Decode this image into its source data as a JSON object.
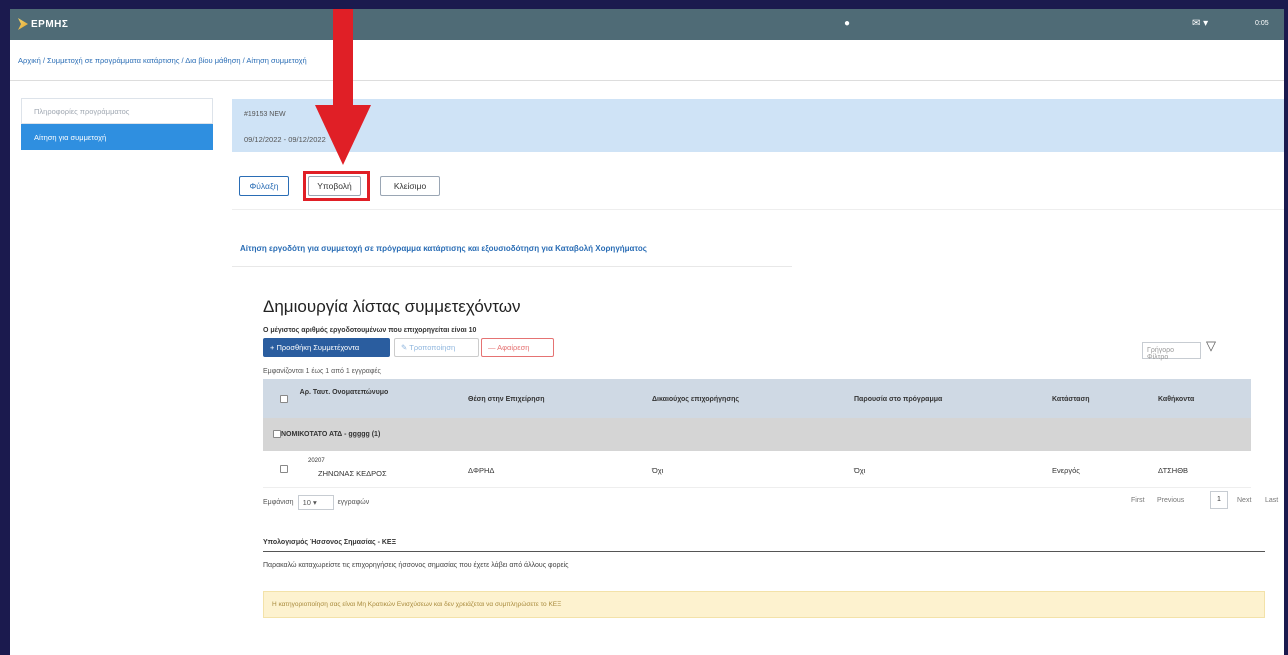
{
  "app": {
    "name": "ΕΡΜΗΣ",
    "time": "0:05"
  },
  "breadcrumb": {
    "text": "Αρχική / Συμμετοχή σε προγράμματα κατάρτισης / Δια βίου μάθηση / Αίτηση συμμετοχή"
  },
  "sidebar": {
    "items": [
      {
        "label": "Πληροφορίες προγράμματος",
        "active": false
      },
      {
        "label": "Αίτηση για συμμετοχή",
        "active": true
      }
    ]
  },
  "header": {
    "id": "#19153 NEW",
    "dates": "09/12/2022 - 09/12/2022"
  },
  "actions": {
    "save": "Φύλαξη",
    "submit": "Υποβολή",
    "close": "Κλείσιμο"
  },
  "application_link": "Αίτηση εργοδότη για συμμετοχή σε πρόγραμμα κατάρτισης και εξουσιοδότηση για Καταβολή Χορηγήματος",
  "participants": {
    "title": "Δημιουργία λίστας συμμετεχόντων",
    "max_note": "Ο μέγιστος αριθμός εργοδοτουμένων που επιχορηγείται είναι 10",
    "add_button": "+ Προσθήκη Συμμετέχοντα",
    "edit_button": "Τροποποίηση",
    "remove_button": "— Αφαίρεση",
    "quick_filter_placeholder": "Γρήγορο Φίλτρο",
    "showing": "Εμφανίζονται 1 έως 1 από 1 εγγραφές",
    "columns": [
      "Αρ. Ταυτ. Ονοματεπώνυμο",
      "Θέση στην Επιχείρηση",
      "Δικαιούχος επιχορήγησης",
      "Παρουσία στο πρόγραμμα",
      "Κατάσταση",
      "Καθήκοντα"
    ],
    "group": "ΝΟΜΙΚΟΤΑΤΟ ΑΤΔ - ggggg (1)",
    "rows": [
      {
        "id": "20207",
        "name": "ΖΗΝΩΝΑΣ ΚΕΔΡΟΣ",
        "position": "ΔΦΡΗΔ",
        "beneficiary": "Όχι",
        "attendance": "Όχι",
        "status": "Ενεργός",
        "duties": "ΔΤΣΗΘΒ"
      }
    ],
    "page_size_label_pre": "Εμφάνιση",
    "page_size": "10",
    "page_size_label_post": "εγγραφών",
    "pager": {
      "first": "First",
      "previous": "Previous",
      "current": "1",
      "next": "Next",
      "last": "Last"
    }
  },
  "kez": {
    "title": "Υπολογισμός Ήσσονος Σημασίας - ΚΕΞ",
    "instruction": "Παρακαλώ καταχωρείστε τις επιχορηγήσεις ήσσονος σημασίας που έχετε λάβει από άλλους φορείς",
    "warning": "Η κατηγοριοποίηση σας είναι Μη Κρατικών Ενισχύσεων και δεν χρειάζεται να συμπληρώσετε το ΚΕΞ"
  },
  "colors": {
    "topbar": "#4f6b76",
    "accent": "#2a5d9f",
    "highlight": "#e01f26",
    "background": "#1b1a4e"
  }
}
